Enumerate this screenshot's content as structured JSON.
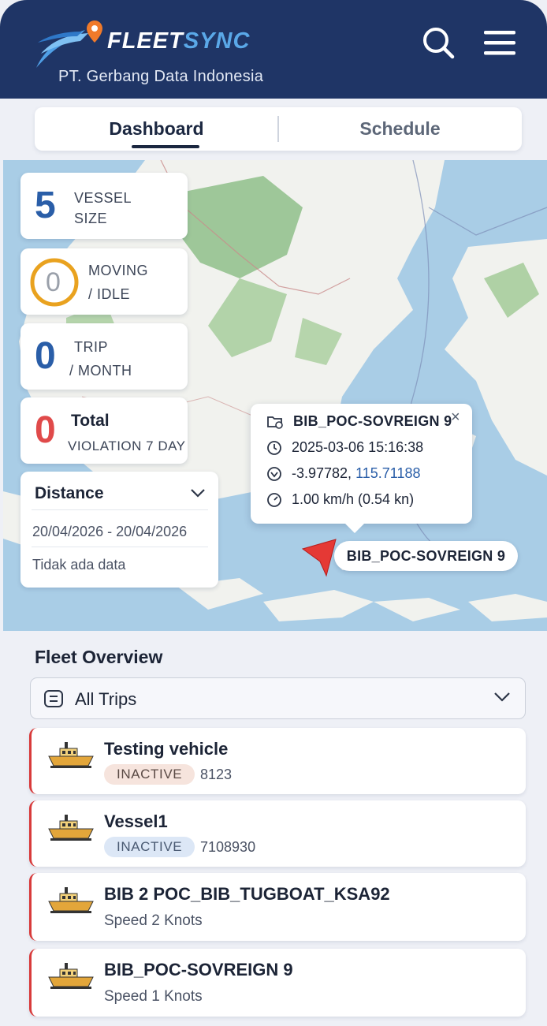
{
  "header": {
    "brand_prefix": "FLEET",
    "brand_suffix": "SYNC",
    "company": "PT. Gerbang Data Indonesia"
  },
  "tabs": [
    {
      "label": "Dashboard",
      "active": true
    },
    {
      "label": "Schedule",
      "active": false
    }
  ],
  "stats": [
    {
      "value": "5",
      "line1": "VESSEL",
      "line2": "SIZE",
      "color": "#2a5ea8"
    },
    {
      "value": "0",
      "line1": "MOVING",
      "line2": "/ IDLE",
      "color": "#9aa0aa",
      "ring_color": "#e9a21f"
    },
    {
      "value": "0",
      "line1": "TRIP",
      "line2": "/ MONTH",
      "color": "#2a5ea8"
    },
    {
      "value": "0",
      "line1": "Total",
      "line2": "VIOLATION 7 DAY",
      "color": "#e04a4a"
    }
  ],
  "distance": {
    "title": "Distance",
    "date_range": "20/04/2026 - 20/04/2026",
    "empty_text": "Tidak ada data"
  },
  "popup": {
    "vessel": "BIB_POC-SOVREIGN 9",
    "timestamp": "2025-03-06 15:16:38",
    "lat": "-3.97782,",
    "lon": "115.71188",
    "speed": "1.00 km/h (0.54 kn)",
    "close": "×"
  },
  "map_marker": {
    "label": "BIB_POC-SOVREIGN 9",
    "color": "#e53935"
  },
  "fleet": {
    "title": "Fleet Overview",
    "filter": "All Trips",
    "items": [
      {
        "name": "Testing vehicle",
        "status": "INACTIVE",
        "id": "8123"
      },
      {
        "name": "Vessel1",
        "status": "INACTIVE",
        "id": "7108930"
      },
      {
        "name": "BIB 2 POC_BIB_TUGBOAT_KSA92",
        "speed": "Speed 2 Knots"
      },
      {
        "name": "BIB_POC-SOVREIGN 9",
        "speed": "Speed 1 Knots"
      }
    ]
  },
  "colors": {
    "header_bg": "#1f3566",
    "accent": "#5aa8e8",
    "status_border": "#d83a3a"
  }
}
